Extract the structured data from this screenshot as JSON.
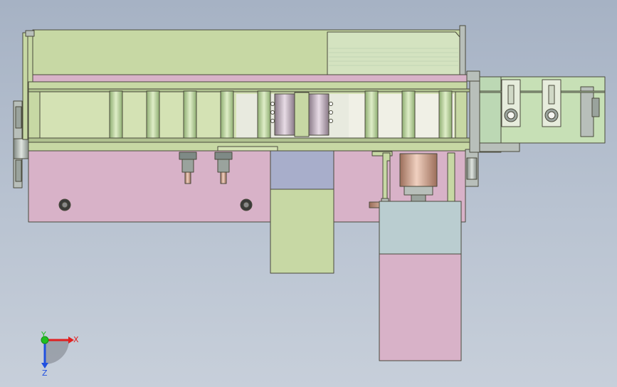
{
  "view": {
    "background_top": "#a6b2c4",
    "background_bottom": "#c7cfda"
  },
  "colors": {
    "green_part": "#c7d8a4",
    "green_light": "#d4e2b4",
    "pink_part": "#d8b2c8",
    "blue_part": "#a8aecb",
    "teal_part": "#bacdd0",
    "grey_part": "#b8bfba",
    "roller": "#b9d19d",
    "copper": "#c8a08a",
    "outline": "#4a4a3c"
  },
  "triad": {
    "x_label": "X",
    "y_label": "Y",
    "z_label": "Z",
    "x_color": "#e02020",
    "y_color": "#20c020",
    "z_color": "#2050e0"
  }
}
